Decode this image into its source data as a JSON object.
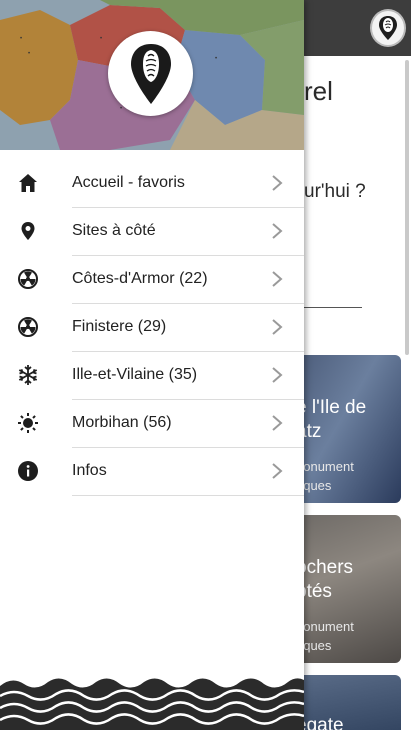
{
  "background": {
    "heading_fragment": "rel",
    "question_fragment": "ur'hui ?",
    "cards": [
      {
        "title_lines": [
          "e l'Ile de",
          "atz"
        ],
        "sub_lines": [
          "nonument",
          "riques"
        ]
      },
      {
        "title_lines": [
          "ochers",
          "ptés"
        ],
        "sub_lines": [
          "nonument",
          "riques"
        ]
      },
      {
        "title_lines": [
          "égate"
        ],
        "sub_lines": []
      }
    ]
  },
  "drawer": {
    "menu": [
      {
        "icon": "home-icon",
        "label": "Accueil - favoris"
      },
      {
        "icon": "location-pin-icon",
        "label": "Sites à côté"
      },
      {
        "icon": "radiation-icon",
        "label": "Côtes-d'Armor (22)"
      },
      {
        "icon": "radiation-icon",
        "label": "Finistere (29)"
      },
      {
        "icon": "snowflake-icon",
        "label": "Ille-et-Vilaine (35)"
      },
      {
        "icon": "sun-icon",
        "label": "Morbihan (56)"
      },
      {
        "icon": "info-icon",
        "label": "Infos"
      }
    ]
  },
  "colors": {
    "header_dark": "#3d3d3d",
    "icon_dark": "#1e1e1e",
    "divider": "#dcdcdc"
  }
}
